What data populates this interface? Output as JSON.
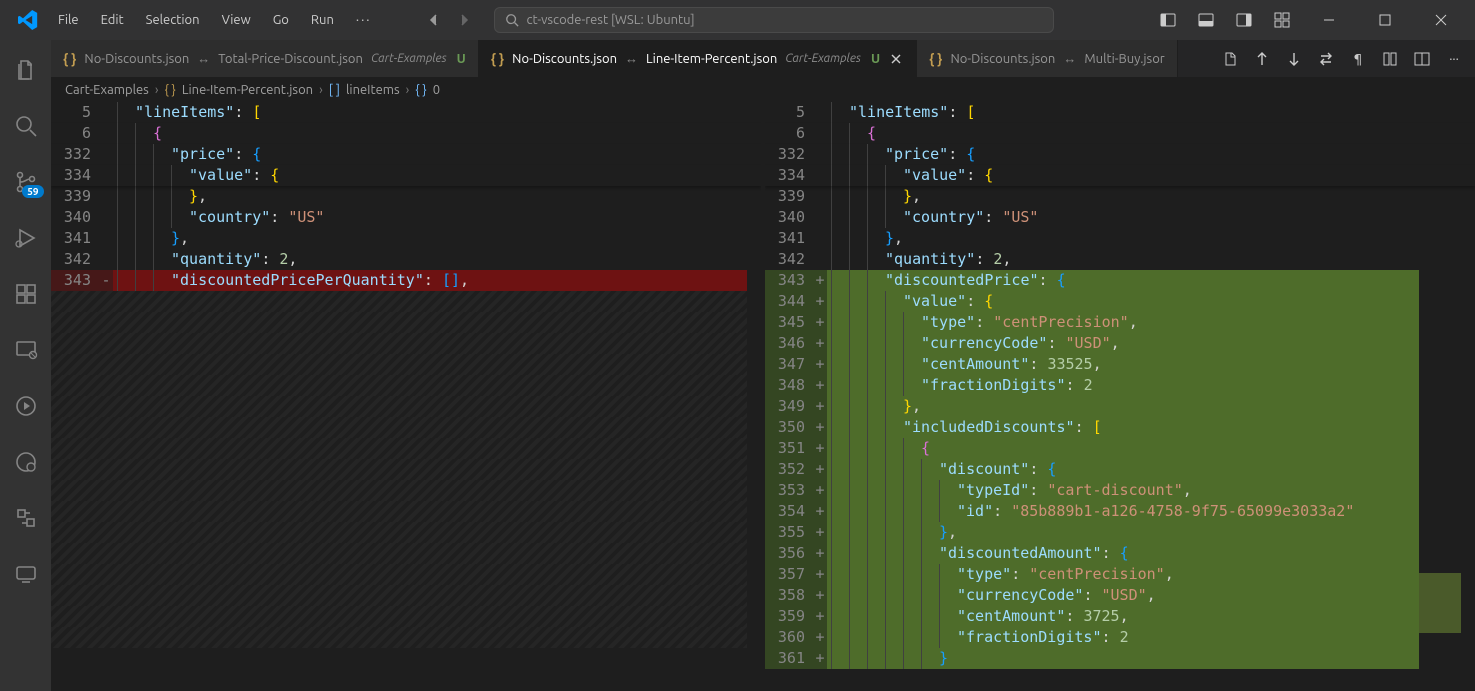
{
  "menu": {
    "file": "File",
    "edit": "Edit",
    "selection": "Selection",
    "view": "View",
    "go": "Go",
    "run": "Run"
  },
  "search": {
    "text": "ct-vscode-rest [WSL: Ubuntu]"
  },
  "activity": {
    "scm_badge": "59"
  },
  "tabs": {
    "t1_left": "No-Discounts.json",
    "t1_right": "Total-Price-Discount.json",
    "t1_dir": "Cart-Examples",
    "t1_mod": "U",
    "t2_left": "No-Discounts.json",
    "t2_right": "Line-Item-Percent.json",
    "t2_dir": "Cart-Examples",
    "t2_mod": "U",
    "t3_left": "No-Discounts.json",
    "t3_right": "Multi-Buy.jsor"
  },
  "breadcrumbs": {
    "p0": "Cart-Examples",
    "p1": "Line-Item-Percent.json",
    "p2": "lineItems",
    "p3": "0"
  },
  "left_lines": [
    {
      "n": "5",
      "content": [
        [
          "key",
          "\"lineItems\""
        ],
        [
          "punc",
          ": "
        ],
        [
          "bracket-y",
          "["
        ]
      ]
    },
    {
      "n": "6",
      "content": [
        [
          "bracket-p",
          "{"
        ]
      ],
      "indent": 1
    },
    {
      "n": "332",
      "content": [
        [
          "key",
          "\"price\""
        ],
        [
          "punc",
          ": "
        ],
        [
          "bracket-b",
          "{"
        ]
      ],
      "indent": 2
    },
    {
      "n": "334",
      "content": [
        [
          "key",
          "\"value\""
        ],
        [
          "punc",
          ": "
        ],
        [
          "bracket-y",
          "{"
        ]
      ],
      "indent": 3
    },
    {
      "n": "339",
      "content": [
        [
          "bracket-y",
          "}"
        ],
        [
          "punc",
          ","
        ]
      ],
      "indent": 3
    },
    {
      "n": "340",
      "content": [
        [
          "key",
          "\"country\""
        ],
        [
          "punc",
          ": "
        ],
        [
          "str",
          "\"US\""
        ]
      ],
      "indent": 3
    },
    {
      "n": "341",
      "content": [
        [
          "bracket-b",
          "}"
        ],
        [
          "punc",
          ","
        ]
      ],
      "indent": 2
    },
    {
      "n": "342",
      "content": [
        [
          "key",
          "\"quantity\""
        ],
        [
          "punc",
          ": "
        ],
        [
          "num",
          "2"
        ],
        [
          "punc",
          ","
        ]
      ],
      "indent": 2
    },
    {
      "n": "343",
      "sign": "-",
      "cls": "removed",
      "content": [
        [
          "key",
          "\"discountedPricePerQuantity\""
        ],
        [
          "punc",
          ": "
        ],
        [
          "bracket-b",
          "["
        ],
        [
          "bracket-b",
          "]"
        ],
        [
          "punc",
          ","
        ]
      ],
      "indent": 2
    }
  ],
  "left_placeholder_count": 17,
  "right_lines": [
    {
      "n": "5",
      "content": [
        [
          "key",
          "\"lineItems\""
        ],
        [
          "punc",
          ": "
        ],
        [
          "bracket-y",
          "["
        ]
      ]
    },
    {
      "n": "6",
      "content": [
        [
          "bracket-p",
          "{"
        ]
      ],
      "indent": 1
    },
    {
      "n": "332",
      "content": [
        [
          "key",
          "\"price\""
        ],
        [
          "punc",
          ": "
        ],
        [
          "bracket-b",
          "{"
        ]
      ],
      "indent": 2
    },
    {
      "n": "334",
      "content": [
        [
          "key",
          "\"value\""
        ],
        [
          "punc",
          ": "
        ],
        [
          "bracket-y",
          "{"
        ]
      ],
      "indent": 3
    },
    {
      "n": "339",
      "content": [
        [
          "bracket-y",
          "}"
        ],
        [
          "punc",
          ","
        ]
      ],
      "indent": 3
    },
    {
      "n": "340",
      "content": [
        [
          "key",
          "\"country\""
        ],
        [
          "punc",
          ": "
        ],
        [
          "str",
          "\"US\""
        ]
      ],
      "indent": 3
    },
    {
      "n": "341",
      "content": [
        [
          "bracket-b",
          "}"
        ],
        [
          "punc",
          ","
        ]
      ],
      "indent": 2
    },
    {
      "n": "342",
      "content": [
        [
          "key",
          "\"quantity\""
        ],
        [
          "punc",
          ": "
        ],
        [
          "num",
          "2"
        ],
        [
          "punc",
          ","
        ]
      ],
      "indent": 2
    },
    {
      "n": "343",
      "sign": "+",
      "cls": "added",
      "content": [
        [
          "key",
          "\"discountedPrice\""
        ],
        [
          "punc",
          ": "
        ],
        [
          "bracket-b",
          "{"
        ]
      ],
      "indent": 2
    },
    {
      "n": "344",
      "sign": "+",
      "cls": "added",
      "content": [
        [
          "key",
          "\"value\""
        ],
        [
          "punc",
          ": "
        ],
        [
          "bracket-y",
          "{"
        ]
      ],
      "indent": 3
    },
    {
      "n": "345",
      "sign": "+",
      "cls": "added",
      "content": [
        [
          "key",
          "\"type\""
        ],
        [
          "punc",
          ": "
        ],
        [
          "str",
          "\"centPrecision\""
        ],
        [
          "punc",
          ","
        ]
      ],
      "indent": 4
    },
    {
      "n": "346",
      "sign": "+",
      "cls": "added",
      "content": [
        [
          "key",
          "\"currencyCode\""
        ],
        [
          "punc",
          ": "
        ],
        [
          "str",
          "\"USD\""
        ],
        [
          "punc",
          ","
        ]
      ],
      "indent": 4
    },
    {
      "n": "347",
      "sign": "+",
      "cls": "added",
      "content": [
        [
          "key",
          "\"centAmount\""
        ],
        [
          "punc",
          ": "
        ],
        [
          "num",
          "33525"
        ],
        [
          "punc",
          ","
        ]
      ],
      "indent": 4
    },
    {
      "n": "348",
      "sign": "+",
      "cls": "added",
      "content": [
        [
          "key",
          "\"fractionDigits\""
        ],
        [
          "punc",
          ": "
        ],
        [
          "num",
          "2"
        ]
      ],
      "indent": 4
    },
    {
      "n": "349",
      "sign": "+",
      "cls": "added",
      "content": [
        [
          "bracket-y",
          "}"
        ],
        [
          "punc",
          ","
        ]
      ],
      "indent": 3
    },
    {
      "n": "350",
      "sign": "+",
      "cls": "added",
      "content": [
        [
          "key",
          "\"includedDiscounts\""
        ],
        [
          "punc",
          ": "
        ],
        [
          "bracket-y",
          "["
        ]
      ],
      "indent": 3
    },
    {
      "n": "351",
      "sign": "+",
      "cls": "added",
      "content": [
        [
          "bracket-p",
          "{"
        ]
      ],
      "indent": 4
    },
    {
      "n": "352",
      "sign": "+",
      "cls": "added",
      "content": [
        [
          "key",
          "\"discount\""
        ],
        [
          "punc",
          ": "
        ],
        [
          "bracket-b",
          "{"
        ]
      ],
      "indent": 5
    },
    {
      "n": "353",
      "sign": "+",
      "cls": "added",
      "content": [
        [
          "key",
          "\"typeId\""
        ],
        [
          "punc",
          ": "
        ],
        [
          "str",
          "\"cart-discount\""
        ],
        [
          "punc",
          ","
        ]
      ],
      "indent": 6
    },
    {
      "n": "354",
      "sign": "+",
      "cls": "added",
      "content": [
        [
          "key",
          "\"id\""
        ],
        [
          "punc",
          ": "
        ],
        [
          "str",
          "\"85b889b1-a126-4758-9f75-65099e3033a2\""
        ]
      ],
      "indent": 6
    },
    {
      "n": "355",
      "sign": "+",
      "cls": "added",
      "content": [
        [
          "bracket-b",
          "}"
        ],
        [
          "punc",
          ","
        ]
      ],
      "indent": 5
    },
    {
      "n": "356",
      "sign": "+",
      "cls": "added",
      "content": [
        [
          "key",
          "\"discountedAmount\""
        ],
        [
          "punc",
          ": "
        ],
        [
          "bracket-b",
          "{"
        ]
      ],
      "indent": 5
    },
    {
      "n": "357",
      "sign": "+",
      "cls": "added",
      "content": [
        [
          "key",
          "\"type\""
        ],
        [
          "punc",
          ": "
        ],
        [
          "str",
          "\"centPrecision\""
        ],
        [
          "punc",
          ","
        ]
      ],
      "indent": 6
    },
    {
      "n": "358",
      "sign": "+",
      "cls": "added",
      "content": [
        [
          "key",
          "\"currencyCode\""
        ],
        [
          "punc",
          ": "
        ],
        [
          "str",
          "\"USD\""
        ],
        [
          "punc",
          ","
        ]
      ],
      "indent": 6
    },
    {
      "n": "359",
      "sign": "+",
      "cls": "added",
      "content": [
        [
          "key",
          "\"centAmount\""
        ],
        [
          "punc",
          ": "
        ],
        [
          "num",
          "3725"
        ],
        [
          "punc",
          ","
        ]
      ],
      "indent": 6
    },
    {
      "n": "360",
      "sign": "+",
      "cls": "added",
      "content": [
        [
          "key",
          "\"fractionDigits\""
        ],
        [
          "punc",
          ": "
        ],
        [
          "num",
          "2"
        ]
      ],
      "indent": 6
    },
    {
      "n": "361",
      "sign": "+",
      "cls": "added",
      "content": [
        [
          "bracket-b",
          "}"
        ]
      ],
      "indent": 5
    }
  ]
}
